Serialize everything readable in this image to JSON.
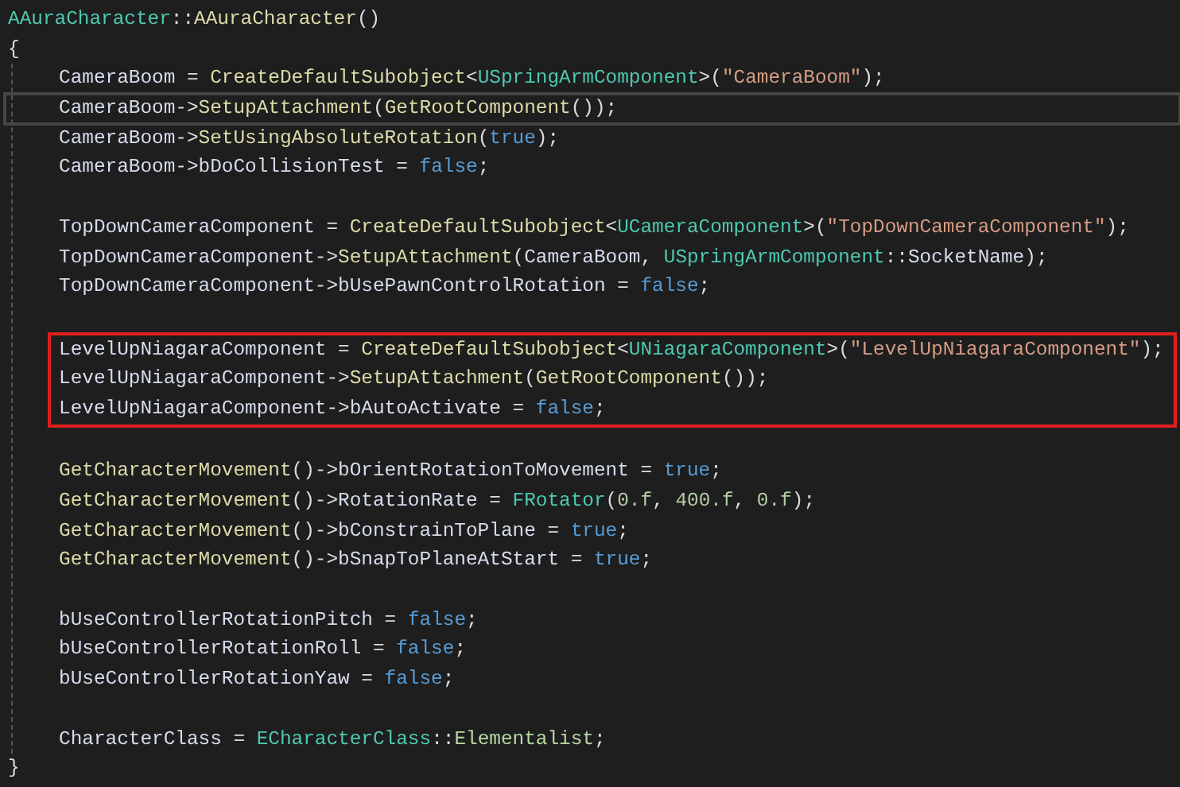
{
  "code": [
    {
      "kind": "line",
      "current": false,
      "tokens": [
        {
          "kind": "type",
          "text": "AAuraCharacter"
        },
        {
          "kind": "plain",
          "text": "::"
        },
        {
          "kind": "func",
          "text": "AAuraCharacter"
        },
        {
          "kind": "plain",
          "text": "()"
        }
      ]
    },
    {
      "kind": "line",
      "current": false,
      "tokens": [
        {
          "kind": "plain",
          "text": "{"
        }
      ]
    },
    {
      "kind": "block",
      "children": [
        {
          "kind": "line",
          "current": false,
          "tokens": [
            {
              "kind": "member",
              "text": "CameraBoom"
            },
            {
              "kind": "plain",
              "text": " = "
            },
            {
              "kind": "func",
              "text": "CreateDefaultSubobject"
            },
            {
              "kind": "plain",
              "text": "<"
            },
            {
              "kind": "type",
              "text": "USpringArmComponent"
            },
            {
              "kind": "plain",
              "text": ">("
            },
            {
              "kind": "string",
              "text": "\"CameraBoom\""
            },
            {
              "kind": "plain",
              "text": ");"
            }
          ]
        },
        {
          "kind": "line",
          "current": true,
          "tokens": [
            {
              "kind": "member",
              "text": "CameraBoom"
            },
            {
              "kind": "plain",
              "text": "->"
            },
            {
              "kind": "func",
              "text": "SetupAttachment"
            },
            {
              "kind": "plain",
              "text": "("
            },
            {
              "kind": "func",
              "text": "GetRootComponent"
            },
            {
              "kind": "plain",
              "text": "());"
            }
          ]
        },
        {
          "kind": "line",
          "current": false,
          "tokens": [
            {
              "kind": "member",
              "text": "CameraBoom"
            },
            {
              "kind": "plain",
              "text": "->"
            },
            {
              "kind": "func",
              "text": "SetUsingAbsoluteRotation"
            },
            {
              "kind": "plain",
              "text": "("
            },
            {
              "kind": "keyword",
              "text": "true"
            },
            {
              "kind": "plain",
              "text": ");"
            }
          ]
        },
        {
          "kind": "line",
          "current": false,
          "tokens": [
            {
              "kind": "member",
              "text": "CameraBoom"
            },
            {
              "kind": "plain",
              "text": "->"
            },
            {
              "kind": "member",
              "text": "bDoCollisionTest"
            },
            {
              "kind": "plain",
              "text": " = "
            },
            {
              "kind": "keyword",
              "text": "false"
            },
            {
              "kind": "plain",
              "text": ";"
            }
          ]
        },
        {
          "kind": "blank"
        },
        {
          "kind": "line",
          "current": false,
          "tokens": [
            {
              "kind": "member",
              "text": "TopDownCameraComponent"
            },
            {
              "kind": "plain",
              "text": " = "
            },
            {
              "kind": "func",
              "text": "CreateDefaultSubobject"
            },
            {
              "kind": "plain",
              "text": "<"
            },
            {
              "kind": "type",
              "text": "UCameraComponent"
            },
            {
              "kind": "plain",
              "text": ">("
            },
            {
              "kind": "string",
              "text": "\"TopDownCameraComponent\""
            },
            {
              "kind": "plain",
              "text": ");"
            }
          ]
        },
        {
          "kind": "line",
          "current": false,
          "tokens": [
            {
              "kind": "member",
              "text": "TopDownCameraComponent"
            },
            {
              "kind": "plain",
              "text": "->"
            },
            {
              "kind": "func",
              "text": "SetupAttachment"
            },
            {
              "kind": "plain",
              "text": "("
            },
            {
              "kind": "member",
              "text": "CameraBoom"
            },
            {
              "kind": "plain",
              "text": ", "
            },
            {
              "kind": "type",
              "text": "USpringArmComponent"
            },
            {
              "kind": "plain",
              "text": "::"
            },
            {
              "kind": "member",
              "text": "SocketName"
            },
            {
              "kind": "plain",
              "text": ");"
            }
          ]
        },
        {
          "kind": "line",
          "current": false,
          "tokens": [
            {
              "kind": "member",
              "text": "TopDownCameraComponent"
            },
            {
              "kind": "plain",
              "text": "->"
            },
            {
              "kind": "member",
              "text": "bUsePawnControlRotation"
            },
            {
              "kind": "plain",
              "text": " = "
            },
            {
              "kind": "keyword",
              "text": "false"
            },
            {
              "kind": "plain",
              "text": ";"
            }
          ]
        },
        {
          "kind": "blank"
        },
        {
          "kind": "highlight",
          "children": [
            {
              "kind": "line",
              "current": false,
              "tokens": [
                {
                  "kind": "member",
                  "text": "LevelUpNiagaraComponent"
                },
                {
                  "kind": "plain",
                  "text": " = "
                },
                {
                  "kind": "func",
                  "text": "CreateDefaultSubobject"
                },
                {
                  "kind": "plain",
                  "text": "<"
                },
                {
                  "kind": "type",
                  "text": "UNiagaraComponent"
                },
                {
                  "kind": "plain",
                  "text": ">("
                },
                {
                  "kind": "string",
                  "text": "\"LevelUpNiagaraComponent\""
                },
                {
                  "kind": "plain",
                  "text": ");"
                }
              ]
            },
            {
              "kind": "line",
              "current": false,
              "tokens": [
                {
                  "kind": "member",
                  "text": "LevelUpNiagaraComponent"
                },
                {
                  "kind": "plain",
                  "text": "->"
                },
                {
                  "kind": "func",
                  "text": "SetupAttachment"
                },
                {
                  "kind": "plain",
                  "text": "("
                },
                {
                  "kind": "func",
                  "text": "GetRootComponent"
                },
                {
                  "kind": "plain",
                  "text": "());"
                }
              ]
            },
            {
              "kind": "line",
              "current": false,
              "tokens": [
                {
                  "kind": "member",
                  "text": "LevelUpNiagaraComponent"
                },
                {
                  "kind": "plain",
                  "text": "->"
                },
                {
                  "kind": "member",
                  "text": "bAutoActivate"
                },
                {
                  "kind": "plain",
                  "text": " = "
                },
                {
                  "kind": "keyword",
                  "text": "false"
                },
                {
                  "kind": "plain",
                  "text": ";"
                }
              ]
            }
          ]
        },
        {
          "kind": "blank"
        },
        {
          "kind": "line",
          "current": false,
          "tokens": [
            {
              "kind": "func",
              "text": "GetCharacterMovement"
            },
            {
              "kind": "plain",
              "text": "()->"
            },
            {
              "kind": "member",
              "text": "bOrientRotationToMovement"
            },
            {
              "kind": "plain",
              "text": " = "
            },
            {
              "kind": "keyword",
              "text": "true"
            },
            {
              "kind": "plain",
              "text": ";"
            }
          ]
        },
        {
          "kind": "line",
          "current": false,
          "tokens": [
            {
              "kind": "func",
              "text": "GetCharacterMovement"
            },
            {
              "kind": "plain",
              "text": "()->"
            },
            {
              "kind": "member",
              "text": "RotationRate"
            },
            {
              "kind": "plain",
              "text": " = "
            },
            {
              "kind": "type",
              "text": "FRotator"
            },
            {
              "kind": "plain",
              "text": "("
            },
            {
              "kind": "number",
              "text": "0.f"
            },
            {
              "kind": "plain",
              "text": ", "
            },
            {
              "kind": "number",
              "text": "400.f"
            },
            {
              "kind": "plain",
              "text": ", "
            },
            {
              "kind": "number",
              "text": "0.f"
            },
            {
              "kind": "plain",
              "text": ");"
            }
          ]
        },
        {
          "kind": "line",
          "current": false,
          "tokens": [
            {
              "kind": "func",
              "text": "GetCharacterMovement"
            },
            {
              "kind": "plain",
              "text": "()->"
            },
            {
              "kind": "member",
              "text": "bConstrainToPlane"
            },
            {
              "kind": "plain",
              "text": " = "
            },
            {
              "kind": "keyword",
              "text": "true"
            },
            {
              "kind": "plain",
              "text": ";"
            }
          ]
        },
        {
          "kind": "line",
          "current": false,
          "tokens": [
            {
              "kind": "func",
              "text": "GetCharacterMovement"
            },
            {
              "kind": "plain",
              "text": "()->"
            },
            {
              "kind": "member",
              "text": "bSnapToPlaneAtStart"
            },
            {
              "kind": "plain",
              "text": " = "
            },
            {
              "kind": "keyword",
              "text": "true"
            },
            {
              "kind": "plain",
              "text": ";"
            }
          ]
        },
        {
          "kind": "blank"
        },
        {
          "kind": "line",
          "current": false,
          "tokens": [
            {
              "kind": "member",
              "text": "bUseControllerRotationPitch"
            },
            {
              "kind": "plain",
              "text": " = "
            },
            {
              "kind": "keyword",
              "text": "false"
            },
            {
              "kind": "plain",
              "text": ";"
            }
          ]
        },
        {
          "kind": "line",
          "current": false,
          "tokens": [
            {
              "kind": "member",
              "text": "bUseControllerRotationRoll"
            },
            {
              "kind": "plain",
              "text": " = "
            },
            {
              "kind": "keyword",
              "text": "false"
            },
            {
              "kind": "plain",
              "text": ";"
            }
          ]
        },
        {
          "kind": "line",
          "current": false,
          "tokens": [
            {
              "kind": "member",
              "text": "bUseControllerRotationYaw"
            },
            {
              "kind": "plain",
              "text": " = "
            },
            {
              "kind": "keyword",
              "text": "false"
            },
            {
              "kind": "plain",
              "text": ";"
            }
          ]
        },
        {
          "kind": "blank"
        },
        {
          "kind": "line",
          "current": false,
          "tokens": [
            {
              "kind": "member",
              "text": "CharacterClass"
            },
            {
              "kind": "plain",
              "text": " = "
            },
            {
              "kind": "type",
              "text": "ECharacterClass"
            },
            {
              "kind": "plain",
              "text": "::"
            },
            {
              "kind": "enum",
              "text": "Elementalist"
            },
            {
              "kind": "plain",
              "text": ";"
            }
          ]
        }
      ]
    },
    {
      "kind": "line",
      "current": false,
      "tokens": [
        {
          "kind": "plain",
          "text": "}"
        }
      ]
    }
  ]
}
